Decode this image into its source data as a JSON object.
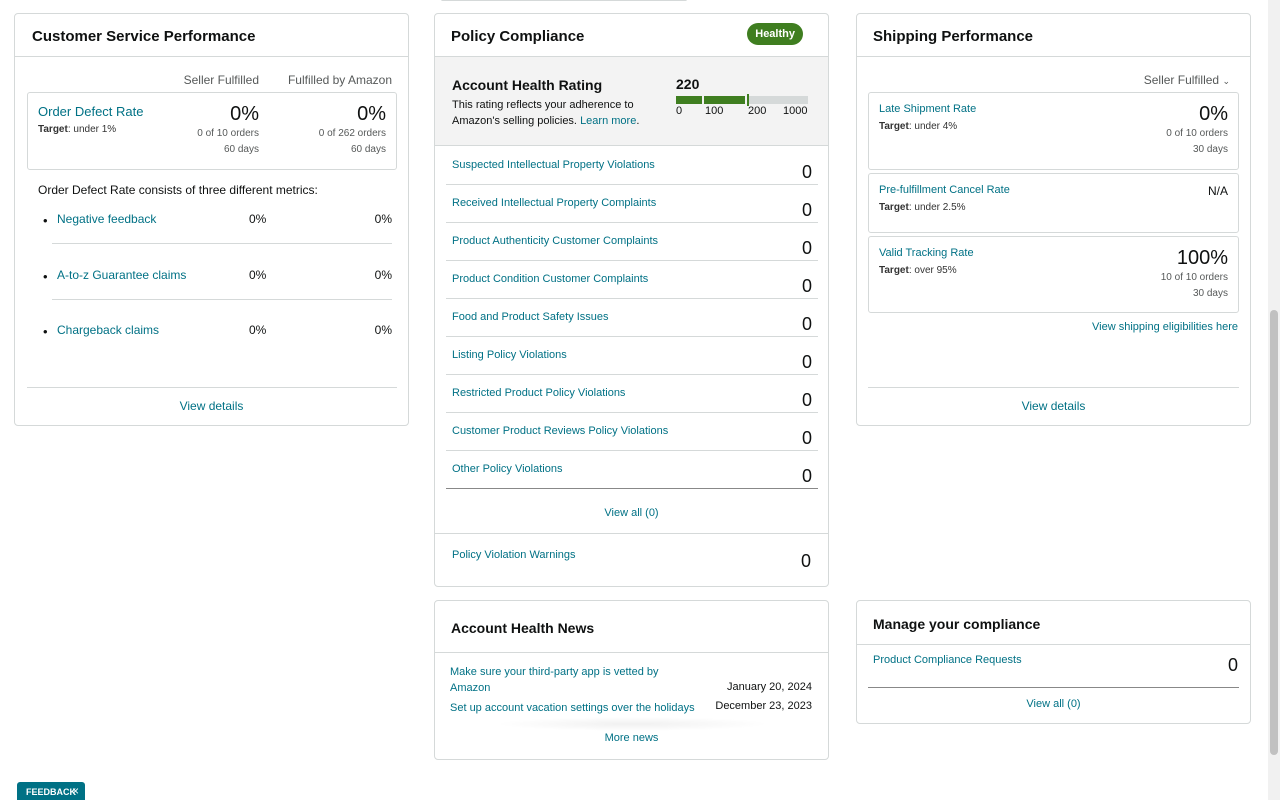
{
  "customer_service": {
    "title": "Customer Service Performance",
    "col_seller": "Seller Fulfilled",
    "col_fba": "Fulfilled by Amazon",
    "odr": {
      "name": "Order Defect Rate",
      "target_label": "Target",
      "target_value": ": under 1%",
      "seller_pct": "0%",
      "seller_orders": "0 of 10 orders",
      "seller_days": "60 days",
      "fba_pct": "0%",
      "fba_orders": "0 of 262 orders",
      "fba_days": "60 days"
    },
    "consists_text": "Order Defect Rate consists of three different metrics:",
    "metrics": [
      {
        "name": "Negative feedback",
        "seller": "0%",
        "fba": "0%"
      },
      {
        "name": "A-to-z Guarantee claims",
        "seller": "0%",
        "fba": "0%"
      },
      {
        "name": "Chargeback claims",
        "seller": "0%",
        "fba": "0%"
      }
    ],
    "view_details": "View details"
  },
  "policy": {
    "title": "Policy Compliance",
    "badge": "Healthy",
    "badge_color": "#3f7e20",
    "ahr_title": "Account Health Rating",
    "ahr_desc": "This rating reflects your adherence to Amazon's selling policies.",
    "ahr_learn_more": "Learn more",
    "ahr_period": ".",
    "ahr_score": "220",
    "meter_labels": [
      "0",
      "100",
      "200",
      "1000"
    ],
    "rows": [
      {
        "name": "Suspected Intellectual Property Violations",
        "count": "0"
      },
      {
        "name": "Received Intellectual Property Complaints",
        "count": "0"
      },
      {
        "name": "Product Authenticity Customer Complaints",
        "count": "0"
      },
      {
        "name": "Product Condition Customer Complaints",
        "count": "0"
      },
      {
        "name": "Food and Product Safety Issues",
        "count": "0"
      },
      {
        "name": "Listing Policy Violations",
        "count": "0"
      },
      {
        "name": "Restricted Product Policy Violations",
        "count": "0"
      },
      {
        "name": "Customer Product Reviews Policy Violations",
        "count": "0"
      },
      {
        "name": "Other Policy Violations",
        "count": "0"
      }
    ],
    "view_all": "View all (0)",
    "warnings_name": "Policy Violation Warnings",
    "warnings_count": "0"
  },
  "shipping": {
    "title": "Shipping Performance",
    "select": "Seller Fulfilled",
    "late": {
      "name": "Late Shipment Rate",
      "target_label": "Target",
      "target_value": ": under 4%",
      "pct": "0%",
      "orders": "0 of 10 orders",
      "days": "30 days"
    },
    "cancel": {
      "name": "Pre-fulfillment Cancel Rate",
      "target_label": "Target",
      "target_value": ": under 2.5%",
      "value": "N/A"
    },
    "tracking": {
      "name": "Valid Tracking Rate",
      "target_label": "Target",
      "target_value": ": over 95%",
      "pct": "100%",
      "orders": "10 of 10 orders",
      "days": "30 days"
    },
    "eligibility_link": "View shipping eligibilities here",
    "view_details": "View details"
  },
  "news": {
    "title": "Account Health News",
    "items": [
      {
        "title": "Make sure your third-party app is vetted by Amazon",
        "date": "January 20, 2024"
      },
      {
        "title": "Set up account vacation settings over the holidays",
        "date": "December 23, 2023"
      }
    ],
    "more": "More news"
  },
  "manage": {
    "title": "Manage your compliance",
    "row_name": "Product Compliance Requests",
    "row_count": "0",
    "view_all": "View all (0)"
  },
  "feedback": {
    "label": "FEEDBACK",
    "close": "×"
  }
}
